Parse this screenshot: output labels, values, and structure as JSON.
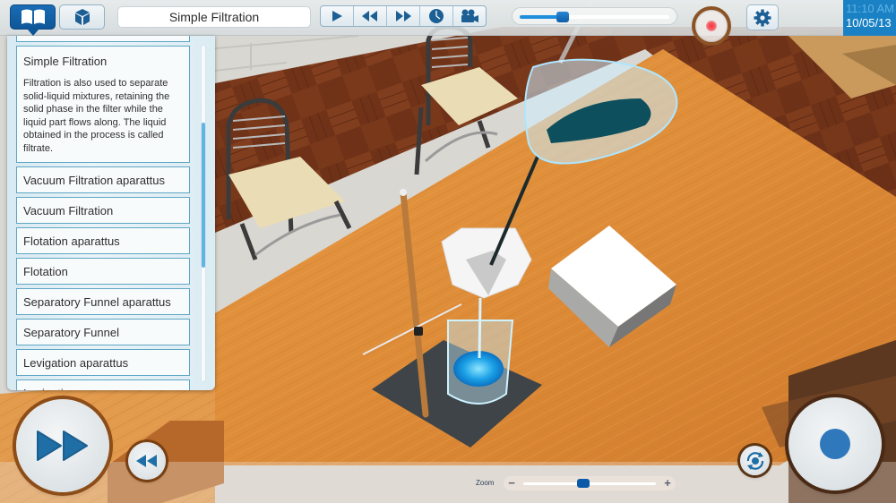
{
  "app": {
    "topbar": {
      "book_button": {
        "icon": "book-icon",
        "active": true
      },
      "model_button": {
        "icon": "cube-icon",
        "active": false
      },
      "title": "Simple Filtration",
      "media_controls": [
        {
          "name": "play",
          "icon": "play-icon"
        },
        {
          "name": "rewind",
          "icon": "rewind-icon"
        },
        {
          "name": "fast-forward",
          "icon": "fast-forward-icon"
        },
        {
          "name": "timer",
          "icon": "clock-icon"
        },
        {
          "name": "camera",
          "icon": "video-camera-icon"
        }
      ],
      "progress": 0.29,
      "record_indicator": {
        "icon": "record-icon",
        "color": "#ff3340"
      },
      "settings_button": {
        "icon": "gear-icon"
      },
      "clock": {
        "time": "11:10 AM",
        "date": "10/05/13"
      }
    },
    "list_panel": {
      "items": [
        {
          "label": "",
          "stub": true
        },
        {
          "label": "Simple Filtration",
          "expanded": true,
          "description": "Filtration is also used to separate solid-liquid mixtures, retaining the solid phase in the filter while the liquid part flows along. The liquid obtained in the process is called filtrate."
        },
        {
          "label": "Vacuum Filtration aparattus"
        },
        {
          "label": "Vacuum Filtration"
        },
        {
          "label": "Flotation aparattus"
        },
        {
          "label": "Flotation"
        },
        {
          "label": "Separatory Funnel aparattus"
        },
        {
          "label": "Separatory Funnel"
        },
        {
          "label": "Levigation aparattus"
        },
        {
          "label": "Levigation"
        }
      ],
      "scroll": {
        "thumb_start": 0.23,
        "thumb_end": 0.66
      }
    },
    "bottombar": {
      "fast_forward_button": {
        "icon": "fast-forward-icon"
      },
      "rewind_button": {
        "icon": "rewind-icon"
      },
      "zoom": {
        "label": "Zoom",
        "minus": "−",
        "plus": "+",
        "value": 0.45
      },
      "rotate_button": {
        "icon": "rotate-camera-icon"
      },
      "action_button": {
        "icon": "action-dot-icon"
      }
    },
    "colors": {
      "accent": "#1a6cb5",
      "icon_blue": "#1c5f94",
      "clock_bg": "#1a82c4",
      "list_border": "#5ea6c4",
      "scroll_thumb": "#5fb5e4"
    }
  }
}
